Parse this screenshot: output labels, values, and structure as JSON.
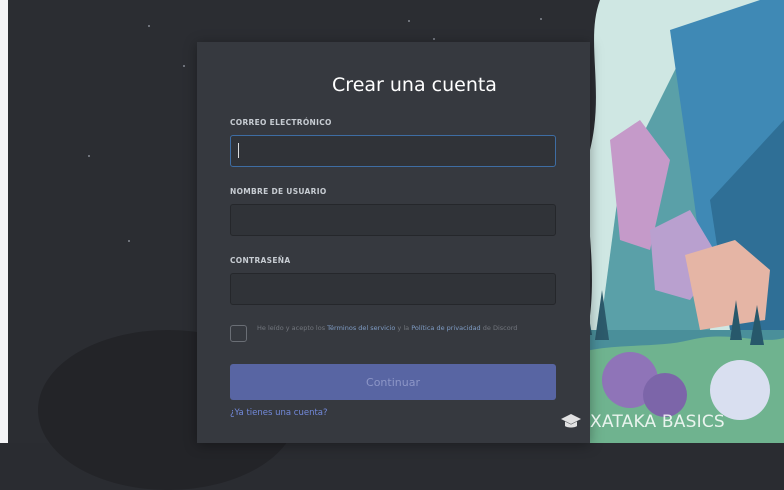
{
  "form": {
    "title": "Crear una cuenta",
    "email_label": "CORREO ELECTRÓNICO",
    "email_value": "",
    "username_label": "NOMBRE DE USUARIO",
    "username_value": "",
    "password_label": "CONTRASEÑA",
    "password_value": "",
    "terms_pre": "He leído y acepto los ",
    "terms_link": "Términos del servicio",
    "terms_mid": " y la ",
    "privacy_link": "Política de privacidad",
    "terms_post": " de Discord",
    "continue_label": "Continuar",
    "login_link": "¿Ya tienes una cuenta?"
  },
  "watermark": {
    "text": "XATAKA BASICS",
    "icon": "graduation-cap-icon"
  },
  "colors": {
    "background": "#2b2d32",
    "card": "#36393f",
    "input": "#303338",
    "button": "#5865a3",
    "link": "#7289da"
  }
}
